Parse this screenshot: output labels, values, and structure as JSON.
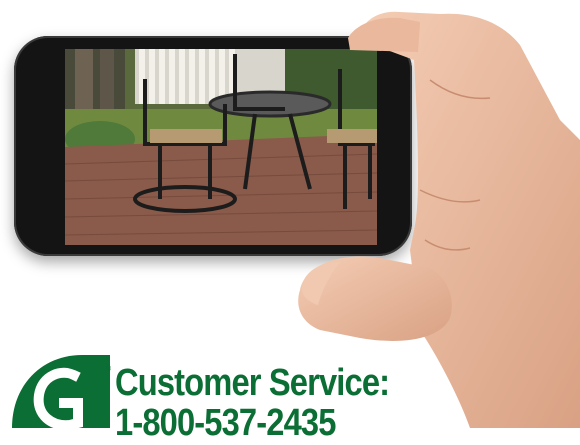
{
  "promo": {
    "service_title": "Customer Service:",
    "phone_number": "1-800-537-2435",
    "logo_letter": "G",
    "registered_mark": "®"
  },
  "colors": {
    "brand_green": "#0b6e34",
    "phone_body": "#141414"
  },
  "icons": {
    "logo": "g-brand-logo-icon",
    "phone": "smartphone-icon",
    "hand": "hand-holding-icon"
  }
}
